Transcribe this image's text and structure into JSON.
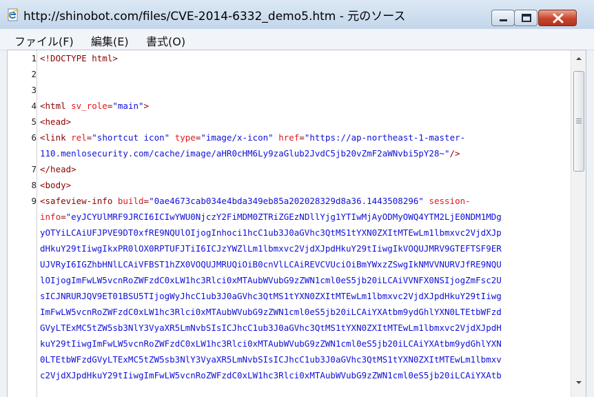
{
  "window": {
    "title": "http://shinobot.com/files/CVE-2014-6332_demo5.htm - 元のソース"
  },
  "menu": {
    "items": [
      "ファイル(F)",
      "編集(E)",
      "書式(O)"
    ]
  },
  "editor": {
    "line_numbers": [
      "1",
      "2",
      "3",
      "4",
      "5",
      "6",
      "7",
      "8",
      "9"
    ],
    "colors": {
      "tag": "#8b0000",
      "attribute": "#e01818",
      "value": "#1010d8"
    },
    "code_lines": [
      [
        {
          "t": "<!DOCTYPE html>",
          "c": "tag"
        }
      ],
      [],
      [],
      [
        {
          "t": "<html ",
          "c": "tag"
        },
        {
          "t": "sv_role",
          "c": "attr"
        },
        {
          "t": "=",
          "c": "tag"
        },
        {
          "t": "\"main\"",
          "c": "val"
        },
        {
          "t": ">",
          "c": "tag"
        }
      ],
      [
        {
          "t": "<head>",
          "c": "tag"
        }
      ],
      [
        {
          "t": "<link ",
          "c": "tag"
        },
        {
          "t": "rel",
          "c": "attr"
        },
        {
          "t": "=",
          "c": "tag"
        },
        {
          "t": "\"shortcut icon\" ",
          "c": "val"
        },
        {
          "t": "type",
          "c": "attr"
        },
        {
          "t": "=",
          "c": "tag"
        },
        {
          "t": "\"image/x-icon\" ",
          "c": "val"
        },
        {
          "t": "href",
          "c": "attr"
        },
        {
          "t": "=",
          "c": "tag"
        },
        {
          "t": "\"https://ap-northeast-1-master-",
          "c": "val"
        }
      ],
      [
        {
          "t": "110.menlosecurity.com/cache/image/aHR0cHM6Ly9zaGlub2JvdC5jb20vZmF2aWNvbi5pY28~\"",
          "c": "val"
        },
        {
          "t": "/>",
          "c": "tag"
        }
      ],
      [
        {
          "t": "</head>",
          "c": "tag"
        }
      ],
      [
        {
          "t": "<body>",
          "c": "tag"
        }
      ],
      [
        {
          "t": "<safeview-info ",
          "c": "tag"
        },
        {
          "t": "build",
          "c": "attr"
        },
        {
          "t": "=",
          "c": "tag"
        },
        {
          "t": "\"0ae4673cab034e4bda349eb85a202028329d8a36.1443508296\" ",
          "c": "val"
        },
        {
          "t": "session-",
          "c": "attr"
        }
      ],
      [
        {
          "t": "info",
          "c": "attr"
        },
        {
          "t": "=",
          "c": "tag"
        },
        {
          "t": "\"eyJCYUlMRF9JRCI6ICIwYWU0NjczY2FiMDM0ZTRiZGEzNDllYjg1YTIwMjAyODMyOWQ4YTM2LjE0NDM1MDg",
          "c": "val"
        }
      ],
      [
        {
          "t": "yOTYiLCAiUFJPVE9DT0xfRE9NQUlOIjogInhoci1hcC1ub3J0aGVhc3QtMS1tYXN0ZXItMTEwLm1lbmxvc2VjdXJp",
          "c": "val"
        }
      ],
      [
        {
          "t": "dHkuY29tIiwgIkxPR0lOX0RPTUFJTiI6ICJzYWZlLm1lbmxvc2VjdXJpdHkuY29tIiwgIkVOQUJMRV9GTEFTSF9ER",
          "c": "val"
        }
      ],
      [
        {
          "t": "UJVRyI6IGZhbHNlLCAiVFBST1hZX0VOQUJMRUQiOiB0cnVlLCAiREVCVUciOiBmYWxzZSwgIkNMVVNURVJfRE9NQU",
          "c": "val"
        }
      ],
      [
        {
          "t": "lOIjogImFwLW5vcnRoZWFzdC0xLW1hc3Rlci0xMTAubWVubG9zZWN1cml0eS5jb20iLCAiVVNFX0NSIjogZmFsc2U",
          "c": "val"
        }
      ],
      [
        {
          "t": "sICJNRURJQV9ET01BSU5TIjogWyJhcC1ub3J0aGVhc3QtMS1tYXN0ZXItMTEwLm1lbmxvc2VjdXJpdHkuY29tIiwg",
          "c": "val"
        }
      ],
      [
        {
          "t": "ImFwLW5vcnRoZWFzdC0xLW1hc3Rlci0xMTAubWVubG9zZWN1cml0eS5jb20iLCAiYXAtbm9ydGhlYXN0LTEtbWFzd",
          "c": "val"
        }
      ],
      [
        {
          "t": "GVyLTExMC5tZW5sb3NlY3VyaXR5LmNvbSIsICJhcC1ub3J0aGVhc3QtMS1tYXN0ZXItMTEwLm1lbmxvc2VjdXJpdH",
          "c": "val"
        }
      ],
      [
        {
          "t": "kuY29tIiwgImFwLW5vcnRoZWFzdC0xLW1hc3Rlci0xMTAubWVubG9zZWN1cml0eS5jb20iLCAiYXAtbm9ydGhlYXN",
          "c": "val"
        }
      ],
      [
        {
          "t": "0LTEtbWFzdGVyLTExMC5tZW5sb3NlY3VyaXR5LmNvbSIsICJhcC1ub3J0aGVhc3QtMS1tYXN0ZXItMTEwLm1lbmxv",
          "c": "val"
        }
      ],
      [
        {
          "t": "c2VjdXJpdHkuY29tIiwgImFwLW5vcnRoZWFzdC0xLW1hc3Rlci0xMTAubWVubG9zZWN1cml0eS5jb20iLCAiYXAtb",
          "c": "val"
        }
      ]
    ]
  }
}
